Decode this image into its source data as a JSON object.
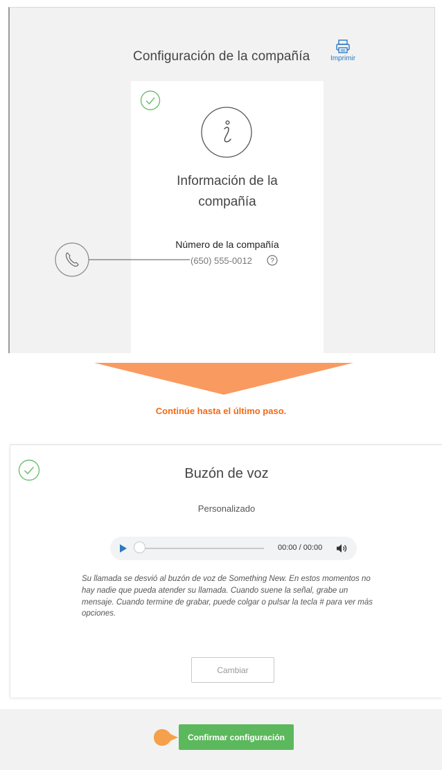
{
  "top_panel": {
    "title": "Configuración de la compañía",
    "print_label": "Imprimir",
    "print_icon": "printer-icon"
  },
  "company_card": {
    "status_icon": "check-circle-icon",
    "main_icon": "info-circle-icon",
    "title_line1": "Información de la",
    "title_line2": "compañía",
    "number_label": "Número de la compañía",
    "number_value": "(650) 555-0012",
    "help_icon": "help-icon",
    "callout_icon": "phone-icon"
  },
  "instruction": {
    "text": "Continúe hasta el último paso.",
    "color": "#f06a1a",
    "arrow_color": "#f99a60"
  },
  "voicemail": {
    "status_icon": "check-circle-icon",
    "title": "Buzón de voz",
    "subtitle": "Personalizado",
    "player": {
      "time": "00:00 / 00:00",
      "progress": 0
    },
    "message": "Su llamada se desvió al buzón de voz de Something New. En estos momentos no hay nadie que pueda atender su llamada. Cuando suene la señal, grabe un mensaje. Cuando termine de grabar, puede colgar o pulsar la tecla # para ver más opciones.",
    "change_button": "Cambiar"
  },
  "footer": {
    "confirm_button": "Confirmar configuración",
    "confirm_color": "#5cb85c",
    "pointer_color": "#f5a04a"
  }
}
